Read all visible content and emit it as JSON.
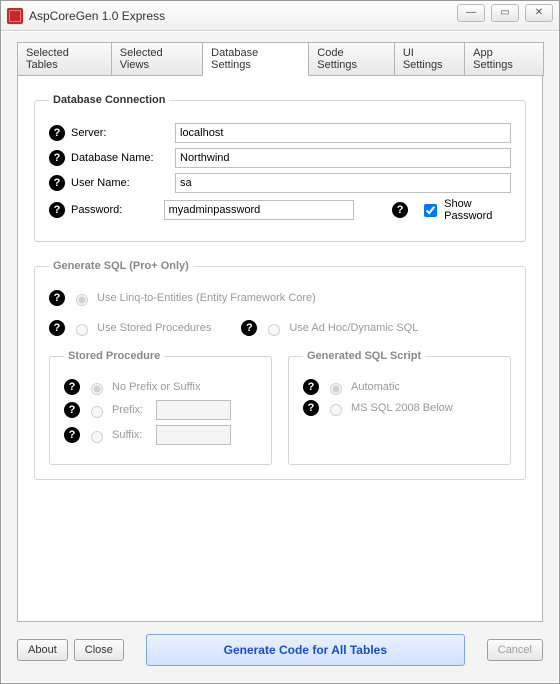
{
  "window": {
    "title": "AspCoreGen 1.0 Express",
    "controls": {
      "minimize": "—",
      "maximize": "▭",
      "close": "✕"
    }
  },
  "tabs": [
    {
      "label": "Selected Tables",
      "active": false
    },
    {
      "label": "Selected Views",
      "active": false
    },
    {
      "label": "Database Settings",
      "active": true
    },
    {
      "label": "Code Settings",
      "active": false
    },
    {
      "label": "UI Settings",
      "active": false
    },
    {
      "label": "App Settings",
      "active": false
    }
  ],
  "dbconn": {
    "legend": "Database Connection",
    "server_label": "Server:",
    "server_value": "localhost",
    "dbname_label": "Database Name:",
    "dbname_value": "Northwind",
    "user_label": "User Name:",
    "user_value": "sa",
    "pass_label": "Password:",
    "pass_value": "myadminpassword",
    "showpass_label": "Show Password"
  },
  "sql": {
    "legend": "Generate SQL (Pro+ Only)",
    "linq_label": "Use Linq-to-Entities (Entity Framework Core)",
    "sproc_label": "Use Stored Procedures",
    "adhoc_label": "Use Ad Hoc/Dynamic SQL",
    "sp_group": {
      "legend": "Stored Procedure",
      "noprefix": "No Prefix or Suffix",
      "prefix": "Prefix:",
      "suffix": "Suffix:"
    },
    "gen_group": {
      "legend": "Generated SQL Script",
      "auto": "Automatic",
      "mssql": "MS SQL 2008  Below"
    }
  },
  "footer": {
    "about": "About",
    "close": "Close",
    "generate": "Generate Code for All Tables",
    "cancel": "Cancel"
  }
}
